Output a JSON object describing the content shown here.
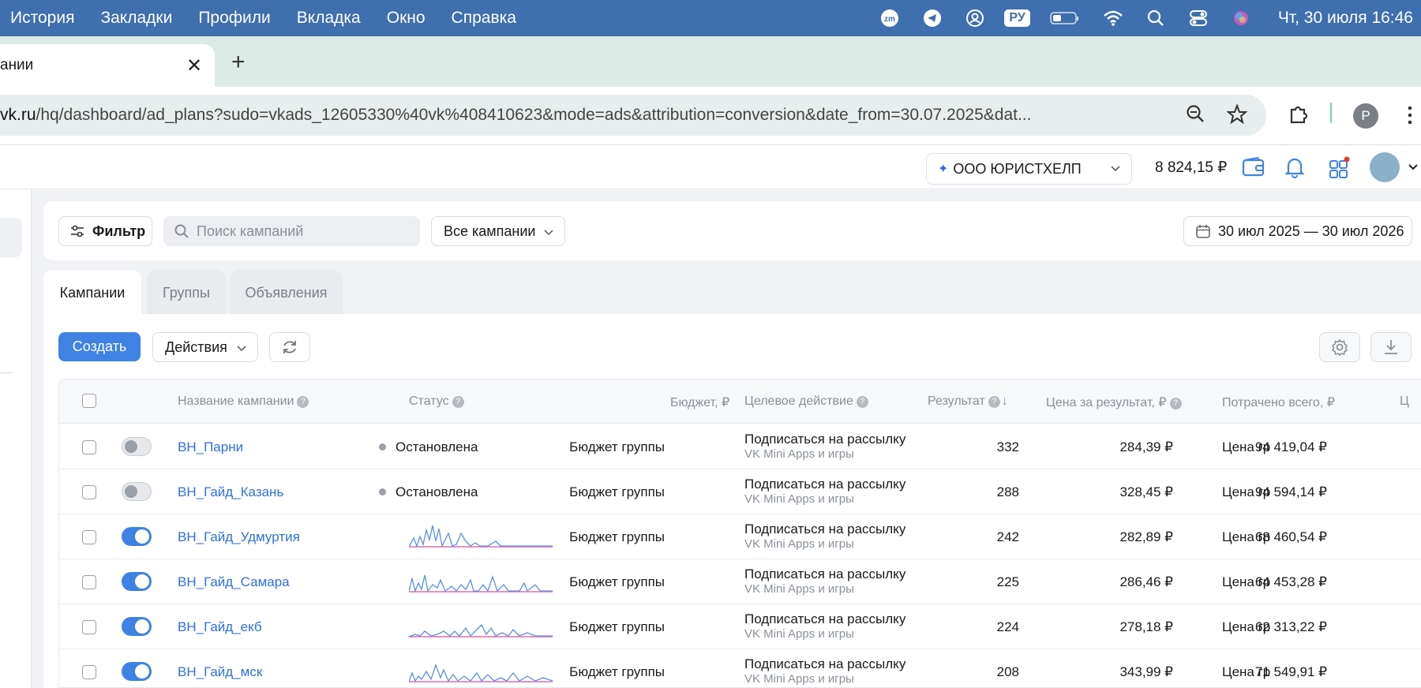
{
  "menubar": {
    "items": [
      "История",
      "Закладки",
      "Профили",
      "Вкладка",
      "Окно",
      "Справка"
    ],
    "lang": "РУ",
    "clock": "Чт, 30 июля  16:46"
  },
  "browser": {
    "tab_title": "ании",
    "url_host": "vk.ru",
    "url_path": "/hq/dashboard/ad_plans?sudo=vkads_12605330%40vk%408410623&mode=ads&attribution=conversion&date_from=30.07.2025&dat...",
    "profile_initial": "P"
  },
  "header": {
    "org_name": "ООО ЮРИСТХЕЛП",
    "balance": "8 824,15 ₽"
  },
  "filters": {
    "filter_label": "Фильтр",
    "search_placeholder": "Поиск кампаний",
    "campaigns_select": "Все кампании",
    "date_range": "30 июл 2025 — 30 июл 2026"
  },
  "tabs": [
    "Кампании",
    "Группы",
    "Объявления"
  ],
  "toolbar": {
    "create_label": "Создать",
    "actions_label": "Действия"
  },
  "table": {
    "columns": {
      "name": "Название кампании",
      "status": "Статус",
      "budget": "Бюджет, ₽",
      "target": "Целевое действие",
      "result": "Результат",
      "price": "Цена за результат, ₽",
      "spent": "Потрачено всего, ₽",
      "next": "Ц"
    },
    "rows": [
      {
        "name": "ВН_Парни",
        "enabled": false,
        "status": "Остановлена",
        "budget": "Бюджет группы",
        "target": "Подписаться на рассылку",
        "target_sub": "VK Mini Apps и игры",
        "result": "332",
        "price": "284,39 ₽",
        "spent": "94 419,04 ₽",
        "next": "Цена гр"
      },
      {
        "name": "ВН_Гайд_Казань",
        "enabled": false,
        "status": "Остановлена",
        "budget": "Бюджет группы",
        "target": "Подписаться на рассылку",
        "target_sub": "VK Mini Apps и игры",
        "result": "288",
        "price": "328,45 ₽",
        "spent": "94 594,14 ₽",
        "next": "Цена гр"
      },
      {
        "name": "ВН_Гайд_Удмуртия",
        "enabled": true,
        "status": "",
        "budget": "Бюджет группы",
        "target": "Подписаться на рассылку",
        "target_sub": "VK Mini Apps и игры",
        "result": "242",
        "price": "282,89 ₽",
        "spent": "68 460,54 ₽",
        "next": "Цена гр"
      },
      {
        "name": "ВН_Гайд_Самара",
        "enabled": true,
        "status": "",
        "budget": "Бюджет группы",
        "target": "Подписаться на рассылку",
        "target_sub": "VK Mini Apps и игры",
        "result": "225",
        "price": "286,46 ₽",
        "spent": "64 453,28 ₽",
        "next": "Цена гр"
      },
      {
        "name": "ВН_Гайд_екб",
        "enabled": true,
        "status": "",
        "budget": "Бюджет группы",
        "target": "Подписаться на рассылку",
        "target_sub": "VK Mini Apps и игры",
        "result": "224",
        "price": "278,18 ₽",
        "spent": "62 313,22 ₽",
        "next": "Цена гр"
      },
      {
        "name": "ВН_Гайд_мск",
        "enabled": true,
        "status": "",
        "budget": "Бюджет группы",
        "target": "Подписаться на рассылку",
        "target_sub": "VK Mini Apps и игры",
        "result": "208",
        "price": "343,99 ₽",
        "spent": "71 549,91 ₽",
        "next": "Цена гр"
      }
    ]
  },
  "colors": {
    "menubar": "#3f6fae",
    "accent": "#3e82e4",
    "link": "#2f6fe0",
    "spark_blue": "#5b8fe0",
    "spark_pink": "#e06bb4"
  }
}
